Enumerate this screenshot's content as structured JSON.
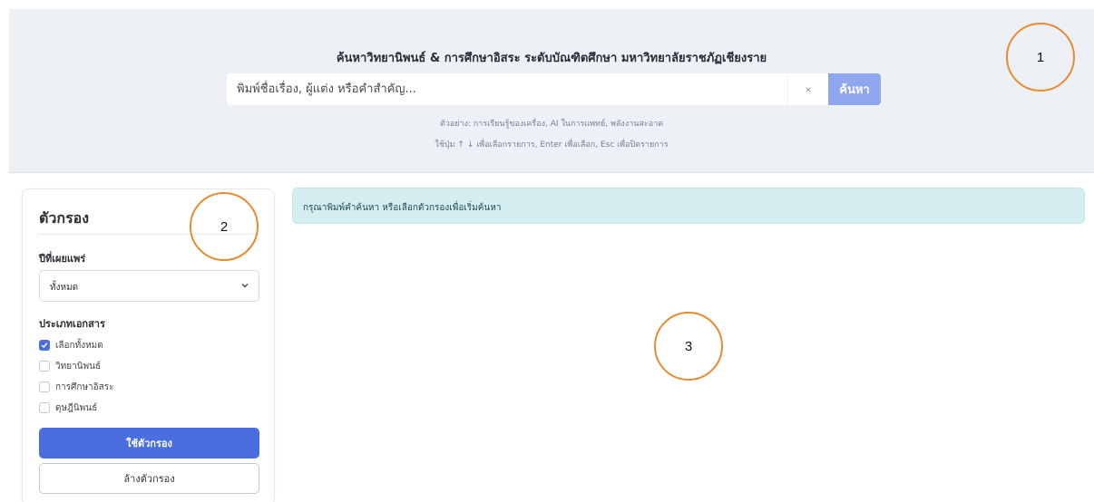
{
  "hero": {
    "title": "ค้นหาวิทยานิพนธ์ & การศึกษาอิสระ ระดับบัณฑิตศึกษา มหาวิทยาลัยราชภัฏเชียงราย",
    "search_placeholder": "พิมพ์ชื่อเรื่อง, ผู้แต่ง หรือคำสำคัญ...",
    "search_value": "",
    "clear_label": "×",
    "search_button_label": "ค้นหา",
    "hint_examples": "ตัวอย่าง: การเรียนรู้ของเครื่อง, AI ในการแพทย์, พลังงานสะอาด",
    "hint_keys": "ใช้ปุ่ม ↑ ↓ เพื่อเลือกรายการ, Enter เพื่อเลือก, Esc เพื่อปิดรายการ"
  },
  "filter": {
    "title": "ตัวกรอง",
    "year_label": "ปีที่เผยแพร่",
    "year_selected": "ทั้งหมด",
    "type_label": "ประเภทเอกสาร",
    "types": [
      {
        "label": "เลือกทั้งหมด",
        "checked": true
      },
      {
        "label": "วิทยานิพนธ์",
        "checked": false
      },
      {
        "label": "การศึกษาอิสระ",
        "checked": false
      },
      {
        "label": "ดุษฎีนิพนธ์",
        "checked": false
      }
    ],
    "apply_label": "ใช้ตัวกรอง",
    "clear_label": "ล้างตัวกรอง"
  },
  "main": {
    "info_message": "กรุณาพิมพ์คำค้นหา หรือเลือกตัวกรองเพื่อเริ่มค้นหา"
  },
  "markers": [
    "1",
    "2",
    "3"
  ],
  "colors": {
    "accent": "#4a6ee0",
    "search_button": "#8ea7ee",
    "hero_bg": "#edf0f5",
    "info_bg": "#d4eef1",
    "marker_ring": "#e88b2f"
  }
}
